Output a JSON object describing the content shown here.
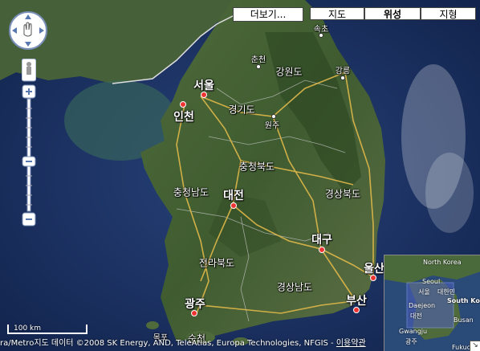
{
  "controls": {
    "more_label": "더보기...",
    "map_type": [
      "지도",
      "위성",
      "지형"
    ],
    "active_type": "위성"
  },
  "cities": {
    "seoul": "서울",
    "incheon": "인천",
    "daejeon": "대전",
    "daegu": "대구",
    "gwangju": "광주",
    "ulsan": "울산",
    "busan": "부산",
    "sokcho": "속초",
    "chuncheon": "춘천",
    "gangneung": "강릉",
    "wonju": "원주",
    "mokpo": "목포",
    "suncheon": "순천"
  },
  "regions": {
    "gangwon": "강원도",
    "gyeonggi": "경기도",
    "chungbuk": "충청북도",
    "chungnam": "충청남도",
    "gyeongbuk": "경상북도",
    "jeonbuk": "전라북도",
    "gyeongnam": "경상남도"
  },
  "scale": {
    "label": "100 km"
  },
  "copyright": {
    "text": "ra/Metro지도 데이터 ©2008 SK Energy, AND, TeleAtlas, Europa Technologies, NFGIS -",
    "terms_link": "이용약관"
  },
  "overview": {
    "north_korea": "North Korea",
    "seoul": "Seoul",
    "seoul_ko": "서울",
    "korea_ko": "대한민",
    "daejeon": "Daejeon",
    "daejeon_ko": "대전",
    "south_korea": "South Korea",
    "gwangju": "Gwangju",
    "gwangju_ko": "광주",
    "busan": "Busan",
    "fukuoka": "Fukuo"
  }
}
